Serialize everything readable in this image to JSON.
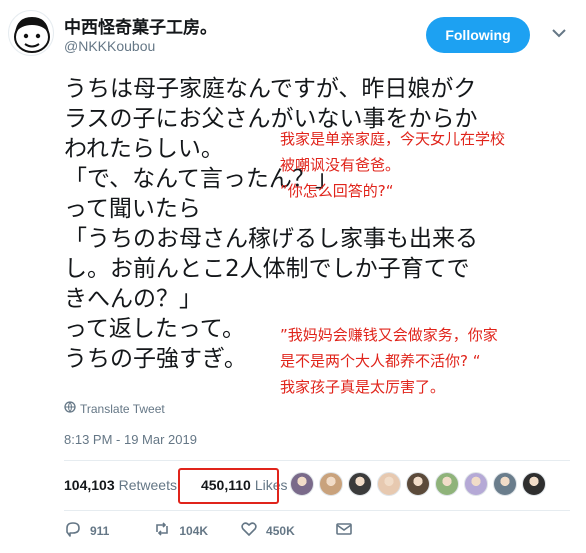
{
  "author": {
    "display_name": "中西怪奇菓子工房。",
    "handle": "@NKKKoubou",
    "follow_label": "Following"
  },
  "tweet": {
    "lines": [
      "うちは母子家庭なんですが、昨日娘がク",
      "ラスの子にお父さんがいない事をからか",
      "われたらしい。",
      "「で、なんて言ったん？」",
      "って聞いたら",
      "「うちのお母さん稼げるし家事も出来る",
      "し。お前んとこ2人体制でしか子育てで",
      "きへんの？」",
      "って返したって。",
      "うちの子強すぎ。"
    ],
    "translate_label": "Translate Tweet",
    "timestamp": "8:13 PM - 19 Mar 2019"
  },
  "overlay": {
    "block1": [
      "我家是单亲家庭，今天女儿在学校",
      "被嘲讽没有爸爸。",
      "”你怎么回答的?“"
    ],
    "block2": [
      "”我妈妈会赚钱又会做家务，你家",
      "是不是两个大人都养不活你? “",
      "我家孩子真是太厉害了。"
    ]
  },
  "stats": {
    "retweets_count": "104,103",
    "retweets_label": "Retweets",
    "likes_count": "450,110",
    "likes_label": "Likes"
  },
  "likers": [
    "#7a6a8a",
    "#c9a27c",
    "#3b3b3b",
    "#e7c9b0",
    "#5b4a3a",
    "#8fb37a",
    "#b5a9d6",
    "#6a7d8c",
    "#2e2e2e"
  ],
  "actions": {
    "replies": "911",
    "retweets": "104K",
    "likes": "450K"
  },
  "colors": {
    "accent": "#1da1f2",
    "highlight": "#e0241b"
  }
}
